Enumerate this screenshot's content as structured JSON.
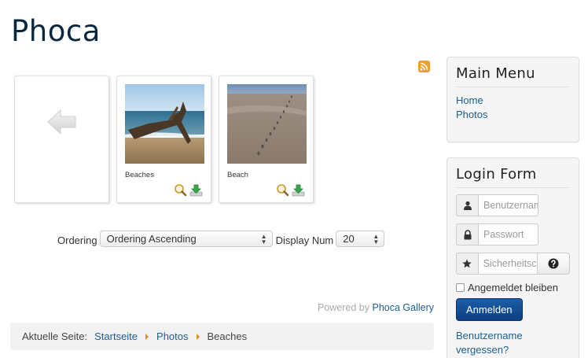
{
  "site": {
    "title": "Phoca"
  },
  "gallery": {
    "items": [
      {
        "caption": "Beaches"
      },
      {
        "caption": "Beach"
      }
    ]
  },
  "ordering": {
    "label": "Ordering",
    "selected": "Ordering Ascending",
    "display_num_label": "Display Num",
    "display_num_selected": "20"
  },
  "powered": {
    "prefix": "Powered by",
    "link": "Phoca Gallery"
  },
  "breadcrumb": {
    "prefix": "Aktuelle Seite:",
    "items": [
      "Startseite",
      "Photos",
      "Beaches"
    ]
  },
  "main_menu": {
    "title": "Main Menu",
    "items": [
      "Home",
      "Photos"
    ]
  },
  "login": {
    "title": "Login Form",
    "username_placeholder": "Benutzername",
    "password_placeholder": "Passwort",
    "secret_placeholder": "Sicherheitscode",
    "remember_label": "Angemeldet bleiben",
    "submit_label": "Anmelden",
    "forgot_label": "Benutzername vergessen?"
  },
  "colors": {
    "link": "#1b5e8f",
    "accent": "#e28a1c",
    "button": "#0e3f80",
    "rss": "#f39c2c"
  }
}
